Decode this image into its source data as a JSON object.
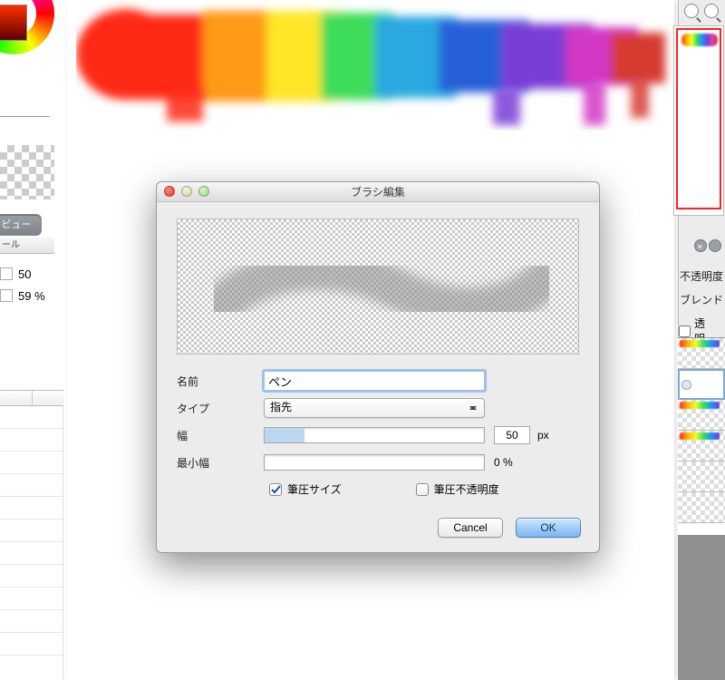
{
  "left": {
    "view_button": "ビュー",
    "tiny_header": "ール",
    "field1_value": "50",
    "field2_value": "59 %"
  },
  "right": {
    "opacity_label": "不透明度",
    "blend_label": "ブレンド",
    "transparent_label": "透明"
  },
  "dialog": {
    "title": "ブラシ編集",
    "labels": {
      "name": "名前",
      "type": "タイプ",
      "width": "幅",
      "min_width": "最小幅",
      "pressure_size": "筆圧サイズ",
      "pressure_opacity": "筆圧不透明度"
    },
    "name_value": "ペン",
    "type_value": "指先",
    "width_value": "50",
    "width_unit": "px",
    "width_fill_pct": 18,
    "min_width_value": "0 %",
    "min_width_fill_pct": 0,
    "pressure_size_checked": true,
    "pressure_opacity_checked": false,
    "cancel": "Cancel",
    "ok": "OK"
  }
}
